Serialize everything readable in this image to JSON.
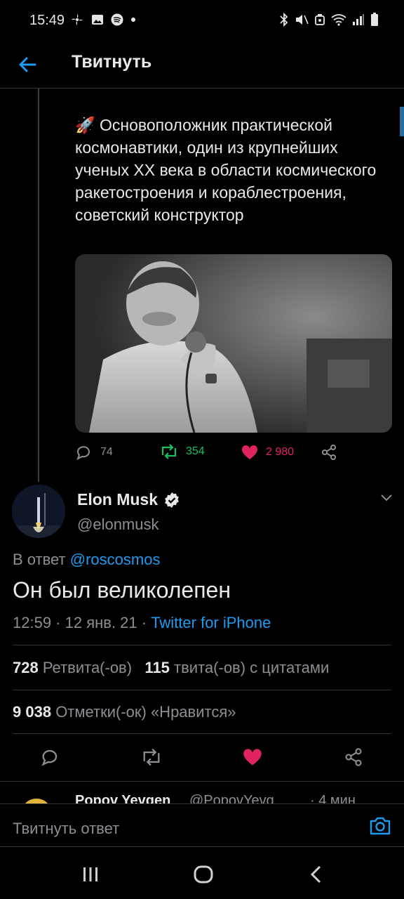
{
  "status_bar": {
    "time": "15:49",
    "left_icons": [
      "pinwheel-icon",
      "gallery-icon",
      "spotify-icon",
      "dot-icon"
    ],
    "right_icons": [
      "bluetooth-icon",
      "mute-icon",
      "alarm-icon",
      "wifi-icon",
      "signal-icon",
      "battery-icon"
    ]
  },
  "app_bar": {
    "title": "Твитнуть"
  },
  "parent_tweet": {
    "text_emoji": "🚀",
    "text": "Основоположник практической космонавтики, один из крупнейших ученых XX века в области космического ракетостроения и кораблестроения, советский конструктор",
    "replies": "74",
    "retweets": "354",
    "likes": "2 980"
  },
  "tweet": {
    "author_name": "Elon Musk",
    "author_handle": "@elonmusk",
    "reply_prefix": "В ответ",
    "reply_to": "@roscosmos",
    "text": "Он был великолепен",
    "time_date": "12:59 · 12 янв. 21 · ",
    "source": "Twitter for iPhone",
    "retweets_count": "728",
    "retweets_label": "Ретвита(-ов)",
    "quotes_count": "115",
    "quotes_label": "твита(-ов) с цитатами",
    "likes_count": "9 038",
    "likes_label": "Отметки(-ок) «Нравится»"
  },
  "next_reply": {
    "name": "Popov Yevgen",
    "handle": "@PopovYevg",
    "time": "· 4 мин"
  },
  "compose": {
    "placeholder": "Твитнуть ответ"
  },
  "colors": {
    "accent": "#1d9bf0",
    "retweet": "#17bf63",
    "like": "#e0245e",
    "muted": "#8b8f94",
    "text": "#e7e9ea"
  }
}
